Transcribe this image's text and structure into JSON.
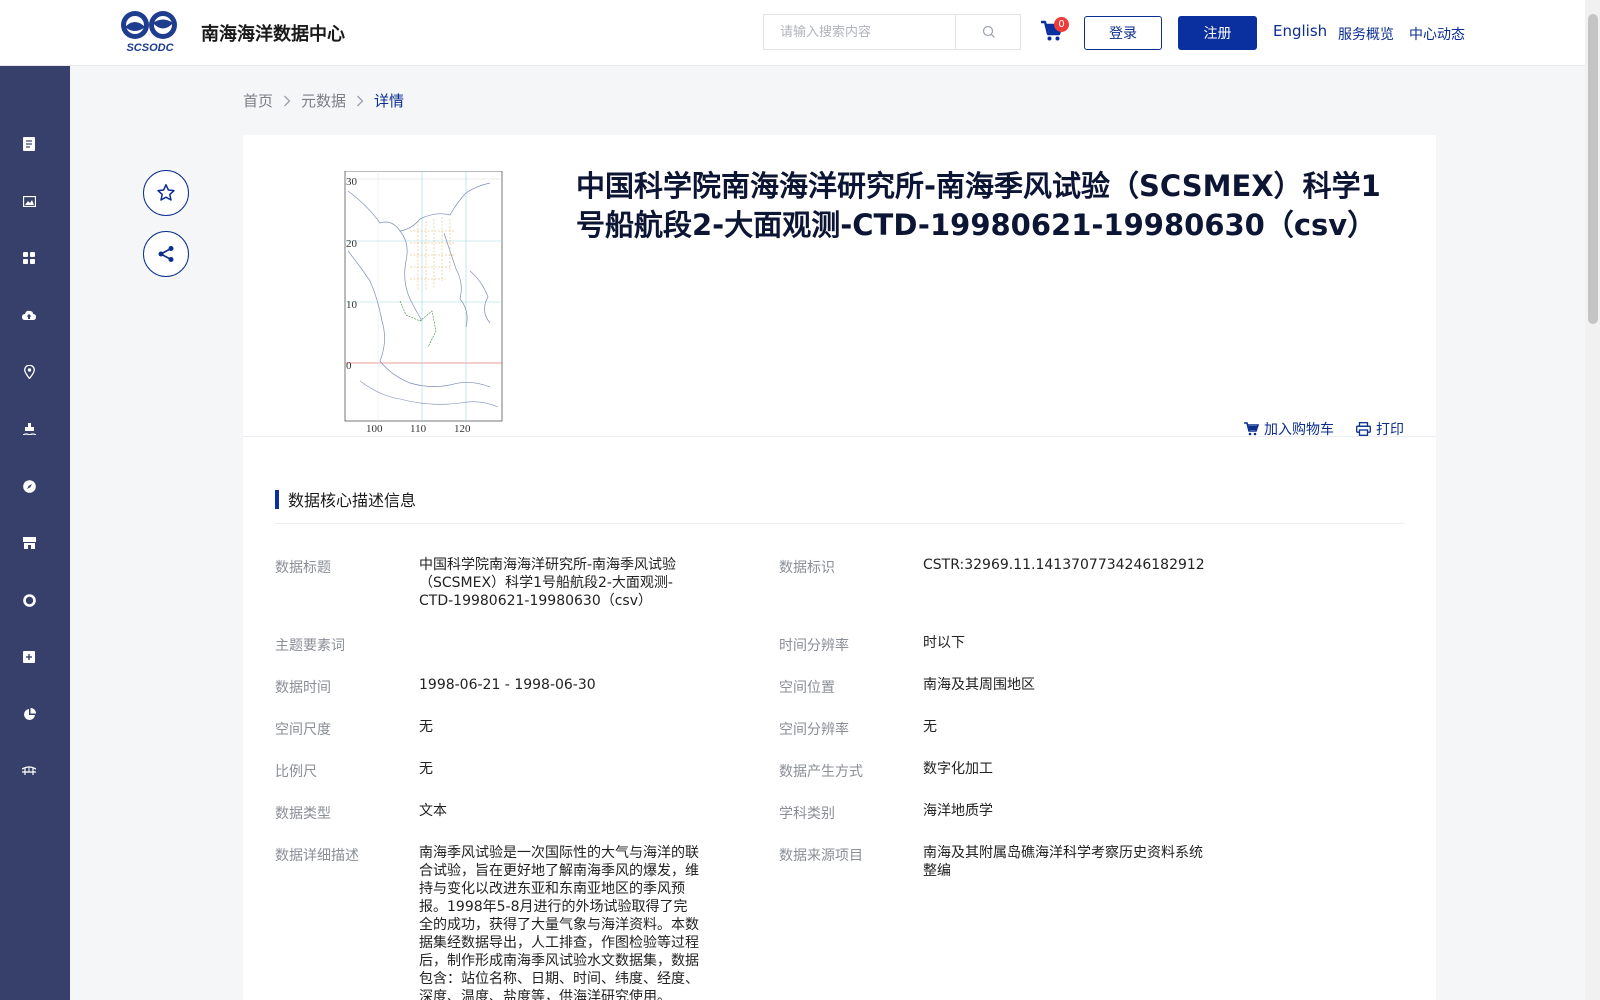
{
  "header": {
    "site_name": "南海海洋数据中心",
    "search_placeholder": "请输入搜索内容",
    "cart_count": "0",
    "login_label": "登录",
    "register_label": "注册",
    "nav": {
      "english": "English",
      "services": "服务概览",
      "news": "中心动态"
    }
  },
  "breadcrumb": {
    "home": "首页",
    "metadata": "元数据",
    "current": "详情"
  },
  "detail": {
    "title": "中国科学院南海海洋研究所-南海季风试验（SCSMEX）科学1号船航段2-大面观测-CTD-19980621-19980630（csv）",
    "map_ticks": {
      "y": [
        "30",
        "20",
        "10",
        "0"
      ],
      "x": [
        "100",
        "110",
        "120"
      ]
    },
    "actions": {
      "add_cart": "加入购物车",
      "print": "打印"
    }
  },
  "section": {
    "title": "数据核心描述信息"
  },
  "fields": {
    "title_label": "数据标题",
    "title_value": "中国科学院南海海洋研究所-南海季风试验（SCSMEX）科学1号船航段2-大面观测-CTD-19980621-19980630（csv）",
    "id_label": "数据标识",
    "id_value": "CSTR:32969.11.1413707734246182912",
    "keyword_label": "主题要素词",
    "keyword_value": "",
    "time_res_label": "时间分辨率",
    "time_res_value": "时以下",
    "time_label": "数据时间",
    "time_value": "1998-06-21 - 1998-06-30",
    "location_label": "空间位置",
    "location_value": "南海及其周围地区",
    "scale_label": "空间尺度",
    "scale_value": "无",
    "space_res_label": "空间分辨率",
    "space_res_value": "无",
    "ratio_label": "比例尺",
    "ratio_value": "无",
    "method_label": "数据产生方式",
    "method_value": "数字化加工",
    "type_label": "数据类型",
    "type_value": "文本",
    "discipline_label": "学科类别",
    "discipline_value": "海洋地质学",
    "desc_label": "数据详细描述",
    "desc_value": "南海季风试验是一次国际性的大气与海洋的联合试验，旨在更好地了解南海季风的爆发，维持与变化以改进东亚和东南亚地区的季风预报。1998年5-8月进行的外场试验取得了完全的成功，获得了大量气象与海洋资料。本数据集经数据导出，人工排查，作图检验等过程后，制作形成南海季风试验水文数据集，数据包含：站位名称、日期、时间、纬度、经度、深度、温度、盐度等，供海洋研究使用。",
    "source_label": "数据来源项目",
    "source_value": "南海及其附属岛礁海洋科学考察历史资料系统整编"
  },
  "colors": {
    "primary": "#0a2f9e",
    "sidebar": "#36406a",
    "badge": "#ee3b3b"
  }
}
